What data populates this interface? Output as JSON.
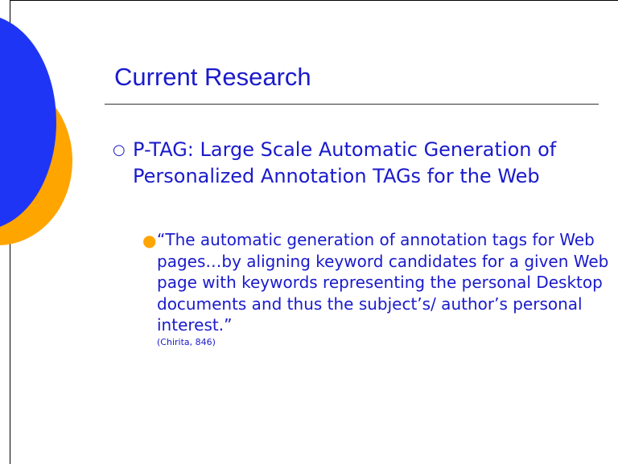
{
  "slide": {
    "title": "Current Research",
    "bullet_level1": {
      "marker": "○",
      "text": "P-TAG: Large Scale Automatic Generation of Personalized Annotation TAGs for the Web"
    },
    "bullet_level2": {
      "marker": "●",
      "text": "“The automatic generation of annotation tags for Web pages…by aligning keyword candidates for a given Web page with keywords representing the personal Desktop documents and thus the subject’s/ author’s personal interest.”",
      "citation": "(Chirita, 846)"
    }
  },
  "colors": {
    "title_text": "#1a1acc",
    "body_text": "#1a1acc",
    "bullet_accent": "#ffa500",
    "decor_blue": "#1f35f5",
    "decor_orange": "#ffa500"
  }
}
